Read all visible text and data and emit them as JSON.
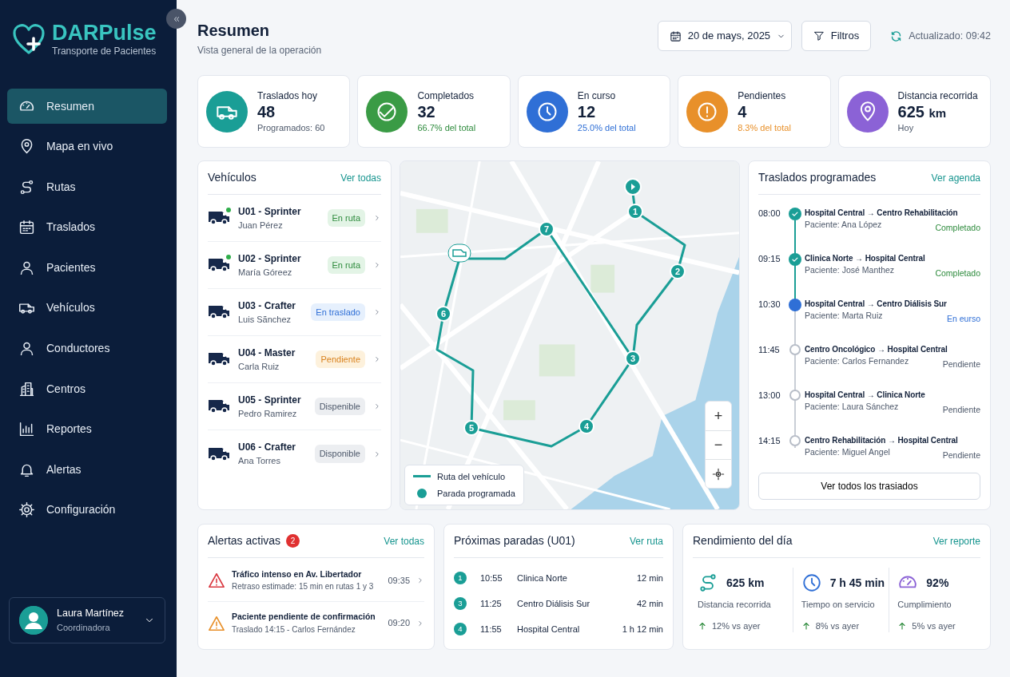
{
  "brand": {
    "name": "DARPulse",
    "tagline": "Transporte de Pacientes"
  },
  "nav": [
    {
      "label": "Resumen",
      "selected": true
    },
    {
      "label": "Mapa en vivo",
      "selected": false
    },
    {
      "label": "Rutas",
      "selected": false
    },
    {
      "label": "Traslados",
      "selected": false
    },
    {
      "label": "Pacientes",
      "selected": false
    },
    {
      "label": "Vehículos",
      "selected": false
    },
    {
      "label": "Conductores",
      "selected": false
    },
    {
      "label": "Centros",
      "selected": false
    },
    {
      "label": "Reportes",
      "selected": false
    },
    {
      "label": "Alertas",
      "selected": false
    },
    {
      "label": "Configuración",
      "selected": false
    }
  ],
  "user": {
    "name": "Laura Martínez",
    "role": "Coordinadora"
  },
  "header": {
    "title": "Resumen",
    "subtitle": "Vista general de la operación",
    "date": "20 de mays, 2025",
    "filter": "Filtros",
    "updated": "Actualizado: 09:42"
  },
  "stats": [
    {
      "label": "Traslados hoy",
      "value": "48",
      "sub": "Programados: 60",
      "color": "#1a9e96",
      "kind": "muted"
    },
    {
      "label": "Completados",
      "value": "32",
      "sub": "66.7% del total",
      "color": "#3a9b45",
      "kind": "green"
    },
    {
      "label": "En curso",
      "value": "12",
      "sub": "25.0% del total",
      "color": "#2f6fd6",
      "kind": "blue"
    },
    {
      "label": "Pendientes",
      "value": "4",
      "sub": "8.3% del total",
      "color": "#e8902a",
      "kind": "orange"
    },
    {
      "label": "Distancia recorrida",
      "value": "625",
      "unit": "km",
      "sub": "Hoy",
      "color": "#8b62d6",
      "kind": "muted"
    }
  ],
  "vehicles": {
    "title": "Vehículos",
    "link": "Ver todas",
    "items": [
      {
        "name": "U01 - Sprinter",
        "driver": "Juan Pérez",
        "status": "En ruta",
        "kind": "green",
        "online": true
      },
      {
        "name": "U02 - Sprinter",
        "driver": "María Góreez",
        "status": "En ruta",
        "kind": "green",
        "online": true
      },
      {
        "name": "U03 - Crafter",
        "driver": "Luis Sãnchez",
        "status": "En traslado",
        "kind": "blue",
        "online": false
      },
      {
        "name": "U04 - Master",
        "driver": "Carla Ruiz",
        "status": "Pendiente",
        "kind": "orange",
        "online": false
      },
      {
        "name": "U05 - Sprinter",
        "driver": "Pedro Ramirez",
        "status": "Dispenible",
        "kind": "grey",
        "online": false
      },
      {
        "name": "U06 - Crafter",
        "driver": "Ana Torres",
        "status": "Disponible",
        "kind": "grey",
        "online": false
      }
    ]
  },
  "map": {
    "stops": [
      "1",
      "2",
      "3",
      "4",
      "5",
      "6",
      "7"
    ],
    "legend": [
      "Ruta del vehículo",
      "Parada programada"
    ],
    "zoom_in": "+",
    "zoom_out": "−"
  },
  "scheduled": {
    "title": "Traslados programades",
    "link": "Ver agenda",
    "button": "Ver todos los trasiados",
    "items": [
      {
        "time": "08:00",
        "route": "Hospital Central → Centro Rehabilitación",
        "patient": "Paciente: Ana López",
        "status": "Completado",
        "kind": "done"
      },
      {
        "time": "09:15",
        "route": "Clinica Norte → Hospital Central",
        "patient": "Paciente: José Manthez",
        "status": "Completado",
        "kind": "done"
      },
      {
        "time": "10:30",
        "route": "Hospital Central → Centro Diálisis Sur",
        "patient": "Paciente: Marta Ruiz",
        "status": "En eurso",
        "kind": "current"
      },
      {
        "time": "11:45",
        "route": "Centro Oncológico → Hospital Central",
        "patient": "Paciente: Carlos Fernandez",
        "status": "Pendiente",
        "kind": "pending"
      },
      {
        "time": "13:00",
        "route": "Hospital Central → Clinica Norte",
        "patient": "Paciente: Laura Sánchez",
        "status": "Pendiente",
        "kind": "pending"
      },
      {
        "time": "14:15",
        "route": "Centro Rehabilitación → Hospital Central",
        "patient": "Paciente: Miguel Angel",
        "status": "Pendiente",
        "kind": "pending"
      }
    ]
  },
  "alerts": {
    "title": "Alertas activas",
    "count": "2",
    "link": "Ver todas",
    "items": [
      {
        "title": "Tráfico intenso en Av. Libertador",
        "detail": "Retraso estimade: 15 min en rutas 1 y 3",
        "time": "09:35",
        "kind": "danger"
      },
      {
        "title": "Paciente pendiente de confirmación",
        "detail": "Traslado 14:15 - Carlos Fernández",
        "time": "09:20",
        "kind": "warning"
      }
    ]
  },
  "next_stops": {
    "title": "Próximas paradas (U01)",
    "link": "Ver ruta",
    "items": [
      {
        "number": "1",
        "time": "10:55",
        "place": "Clinica Norte",
        "eta": "12 min"
      },
      {
        "number": "3",
        "time": "11:25",
        "place": "Centro Diálisis Sur",
        "eta": "42 min"
      },
      {
        "number": "4",
        "time": "11:55",
        "place": "Hospital Central",
        "eta": "1 h 12 min"
      }
    ]
  },
  "performance": {
    "title": "Rendimiento del día",
    "link": "Ver reporte",
    "items": [
      {
        "value": "625 km",
        "label": "Distancia recorrida",
        "change": "12% vs ayer"
      },
      {
        "value": "7 h 45 min",
        "label": "Tiempo on servicio",
        "change": "8% vs ayer"
      },
      {
        "value": "92%",
        "label": "Cumplimiento",
        "change": "5% vs ayer"
      }
    ]
  }
}
